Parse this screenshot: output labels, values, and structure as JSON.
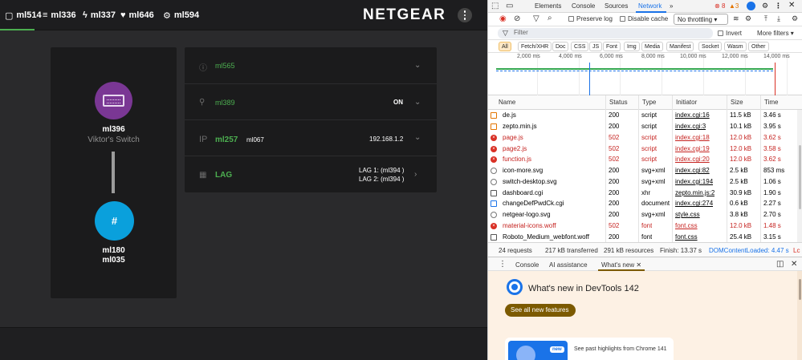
{
  "app": {
    "nav": [
      {
        "icon": "square-icon",
        "glyph": "▢",
        "label": "ml514"
      },
      {
        "icon": "filter-list-icon",
        "glyph": "≡",
        "label": "ml336"
      },
      {
        "icon": "bolt-icon",
        "glyph": "ϟ",
        "label": "ml337"
      },
      {
        "icon": "heart-pulse-icon",
        "glyph": "♥",
        "label": "ml646"
      },
      {
        "icon": "gear-icon",
        "glyph": "⚙",
        "label": "ml594"
      }
    ],
    "logo": "NETGEAR",
    "device": {
      "name": "ml396",
      "subtitle": "Viktor's Switch",
      "hash": "#",
      "line1": "ml180",
      "line2": "ml035"
    },
    "panel": {
      "rows": [
        {
          "icon": "info-icon",
          "glyph": "ⓘ",
          "label": "ml565",
          "value": ""
        },
        {
          "icon": "lightbulb-icon",
          "glyph": "⚲",
          "label": "ml389",
          "value": "ON"
        },
        {
          "icon": "ip-icon",
          "glyph": "IP",
          "label": "ml257",
          "label2": "ml067",
          "value": "192.168.1.2"
        },
        {
          "icon": "lag-icon",
          "glyph": "▦",
          "label": "LAG",
          "value": "LAG 1: (ml394 )",
          "value2": "LAG 2: (ml394 )"
        }
      ]
    }
  },
  "devtools": {
    "tabs": [
      "Elements",
      "Console",
      "Sources",
      "Network",
      "»"
    ],
    "active_tab": "Network",
    "errors": "8",
    "warnings": "3",
    "toolbar": {
      "preserve_log": "Preserve log",
      "disable_cache": "Disable cache",
      "throttling": "No throttling"
    },
    "filter": {
      "placeholder": "Filter",
      "invert": "Invert",
      "more_filters": "More filters"
    },
    "types": [
      "All",
      "Fetch/XHR",
      "Doc",
      "CSS",
      "JS",
      "Font",
      "Img",
      "Media",
      "Manifest",
      "Socket",
      "Wasm",
      "Other"
    ],
    "timeline_labels": [
      "2,000 ms",
      "4,000 ms",
      "6,000 ms",
      "8,000 ms",
      "10,000 ms",
      "12,000 ms",
      "14,000 ms"
    ],
    "columns": [
      "Name",
      "Status",
      "Type",
      "Initiator",
      "Size",
      "Time"
    ],
    "rows": [
      {
        "name": "de.js",
        "status": "200",
        "type": "script",
        "initiator": "index.cgi:16",
        "size": "11.5 kB",
        "time": "3.46 s",
        "err": false,
        "icon": "js-file-icon"
      },
      {
        "name": "zepto.min.js",
        "status": "200",
        "type": "script",
        "initiator": "index.cgi:3",
        "size": "10.1 kB",
        "time": "3.95 s",
        "err": false,
        "icon": "js-file-icon"
      },
      {
        "name": "page.js",
        "status": "502",
        "type": "script",
        "initiator": "index.cgi:18",
        "size": "12.0 kB",
        "time": "3.62 s",
        "err": true,
        "icon": "error-icon"
      },
      {
        "name": "page2.js",
        "status": "502",
        "type": "script",
        "initiator": "index.cgi:19",
        "size": "12.0 kB",
        "time": "3.58 s",
        "err": true,
        "icon": "error-icon"
      },
      {
        "name": "function.js",
        "status": "502",
        "type": "script",
        "initiator": "index.cgi:20",
        "size": "12.0 kB",
        "time": "3.62 s",
        "err": true,
        "icon": "error-icon"
      },
      {
        "name": "icon-more.svg",
        "status": "200",
        "type": "svg+xml",
        "initiator": "index.cgi:82",
        "size": "2.5 kB",
        "time": "853 ms",
        "err": false,
        "icon": "image-file-icon"
      },
      {
        "name": "switch-desktop.svg",
        "status": "200",
        "type": "svg+xml",
        "initiator": "index.cgi:194",
        "size": "2.5 kB",
        "time": "1.06 s",
        "err": false,
        "icon": "image-file-icon"
      },
      {
        "name": "dashboard.cgi",
        "status": "200",
        "type": "xhr",
        "initiator": "zepto.min.js:2",
        "size": "30.9 kB",
        "time": "1.90 s",
        "err": false,
        "icon": "xhr-file-icon"
      },
      {
        "name": "changeDefPwdCk.cgi",
        "status": "200",
        "type": "document",
        "initiator": "index.cgi:274",
        "size": "0.6 kB",
        "time": "2.27 s",
        "err": false,
        "icon": "document-file-icon"
      },
      {
        "name": "netgear-logo.svg",
        "status": "200",
        "type": "svg+xml",
        "initiator": "style.css",
        "size": "3.8 kB",
        "time": "2.70 s",
        "err": false,
        "icon": "image-file-icon"
      },
      {
        "name": "material-icons.woff",
        "status": "502",
        "type": "font",
        "initiator": "font.css",
        "size": "12.0 kB",
        "time": "1.48 s",
        "err": true,
        "icon": "error-icon"
      },
      {
        "name": "Roboto_Medium_webfont.woff",
        "status": "200",
        "type": "font",
        "initiator": "font.css",
        "size": "25.4 kB",
        "time": "3.15 s",
        "err": false,
        "icon": "font-file-icon"
      }
    ],
    "status": {
      "requests": "24 requests",
      "transferred": "217 kB transferred",
      "resources": "291 kB resources",
      "finish": "Finish: 13.37 s",
      "dom": "DOMContentLoaded: 4.47 s",
      "load": "Lc"
    },
    "drawer_tabs": [
      "Console",
      "AI assistance",
      "What's new"
    ],
    "whats_new": {
      "title": "What's new in DevTools 142",
      "button": "See all new features",
      "badge": "new",
      "past": "See past highlights from Chrome 141"
    }
  }
}
